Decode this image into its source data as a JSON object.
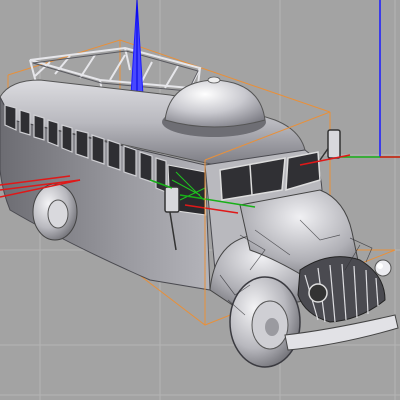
{
  "viewport": {
    "mode": "perspective-3d",
    "render_style": "shaded-with-wireframe",
    "selection": "bus-model",
    "background_color": "#a3a3a3",
    "grid_line_color": "#b5b5b5",
    "bounding_box_color": "#e8903a",
    "axis_colors": {
      "x": "#e01818",
      "y": "#18b018",
      "z": "#1a1aff"
    },
    "model_color": "#c8c8cc"
  },
  "icons": {
    "world_axes": "world-axes-gizmo",
    "local_axes": "local-axes-gizmo"
  }
}
